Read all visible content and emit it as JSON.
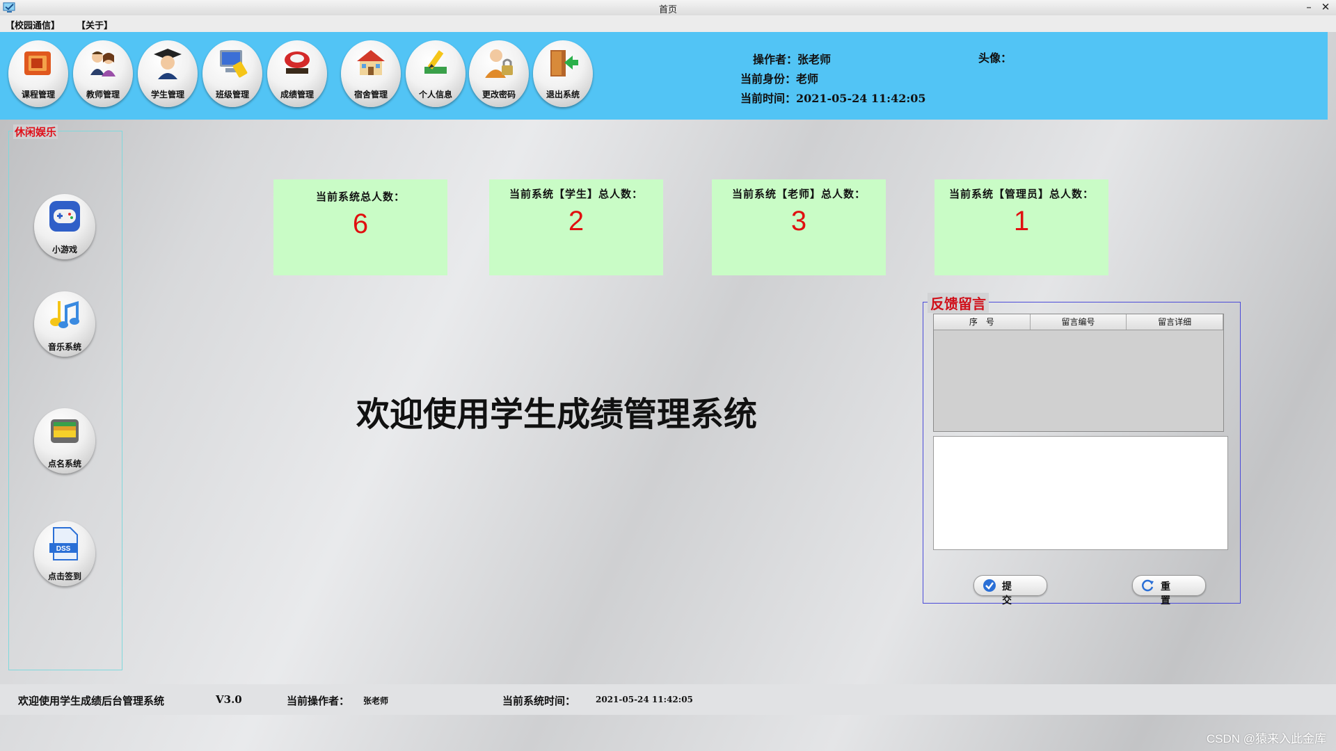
{
  "window": {
    "title": "首页",
    "minimize_glyph": "–",
    "close_glyph": "✕"
  },
  "menu": [
    "【校园通信】",
    "【关于】"
  ],
  "toolbar": [
    {
      "label": "课程管理",
      "icon": "folders-icon"
    },
    {
      "label": "教师管理",
      "icon": "teachers-icon"
    },
    {
      "label": "学生管理",
      "icon": "graduate-icon"
    },
    {
      "label": "班级管理",
      "icon": "computer-icon"
    },
    {
      "label": "成绩管理",
      "icon": "gradebook-icon"
    },
    {
      "label": "宿舍管理",
      "icon": "house-icon"
    },
    {
      "label": "个人信息",
      "icon": "edit-icon"
    },
    {
      "label": "更改密码",
      "icon": "user-lock-icon"
    },
    {
      "label": "退出系统",
      "icon": "exit-door-icon"
    }
  ],
  "header_info": {
    "operator": "操作者：张老师",
    "identity": "当前身份：老师",
    "time": "当前时间：2021-05-24 11:42:05",
    "avatar_label": "头像："
  },
  "leisure": {
    "title": "休闲娱乐",
    "items": [
      {
        "label": "小游戏",
        "icon": "gamepad-icon"
      },
      {
        "label": "音乐系统",
        "icon": "music-note-icon"
      },
      {
        "label": "点名系统",
        "icon": "wallet-icon"
      },
      {
        "label": "点击签到",
        "icon": "dss-file-icon"
      }
    ]
  },
  "stats": [
    {
      "caption": "当前系统总人数：",
      "value": "6"
    },
    {
      "caption": "当前系统【学生】总人数：",
      "value": "2"
    },
    {
      "caption": "当前系统【老师】总人数：",
      "value": "3"
    },
    {
      "caption": "当前系统【管理员】总人数：",
      "value": "1"
    }
  ],
  "welcome": "欢迎使用学生成绩管理系统",
  "feedback": {
    "title": "反馈留言",
    "columns": [
      "序　号",
      "留言编号",
      "留言详细"
    ],
    "message_value": "",
    "submit_label": "提 交",
    "reset_label": "重 置"
  },
  "statusbar": {
    "welcome": "欢迎使用学生成绩后台管理系统",
    "version": "V3.0",
    "operator_label": "当前操作者：",
    "operator_value": "张老师",
    "time_label": "当前系统时间：",
    "time_value": "2021-05-24 11:42:05"
  },
  "watermark": "CSDN @猿来入此金库",
  "colors": {
    "header": "#52c4f5",
    "stat_card": "#c9fcc6",
    "stat_number": "#e01010",
    "legend_red": "#e0101a",
    "feedback_border": "#4a4ad8"
  }
}
